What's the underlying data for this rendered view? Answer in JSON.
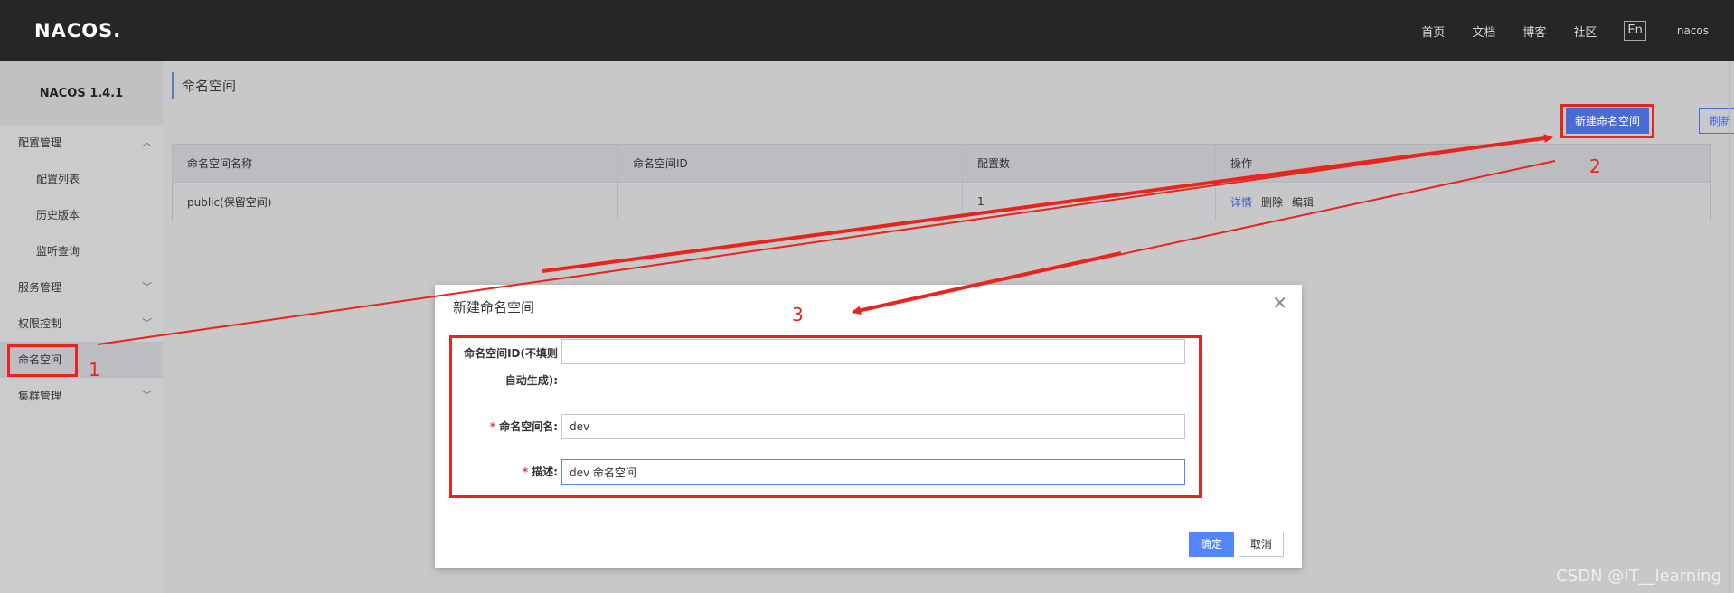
{
  "header": {
    "logo": "NACOS.",
    "nav": [
      "首页",
      "文档",
      "博客",
      "社区"
    ],
    "lang": "En",
    "user": "nacos"
  },
  "sidebar": {
    "version": "NACOS 1.4.1",
    "items": [
      {
        "label": "配置管理",
        "type": "group",
        "chevron": "up"
      },
      {
        "label": "配置列表",
        "type": "sub"
      },
      {
        "label": "历史版本",
        "type": "sub"
      },
      {
        "label": "监听查询",
        "type": "sub"
      },
      {
        "label": "服务管理",
        "type": "group",
        "chevron": "down"
      },
      {
        "label": "权限控制",
        "type": "group",
        "chevron": "down"
      },
      {
        "label": "命名空间",
        "type": "item",
        "active": true
      },
      {
        "label": "集群管理",
        "type": "group",
        "chevron": "down"
      }
    ]
  },
  "main": {
    "title": "命名空间",
    "new_button": "新建命名空间",
    "refresh_button": "刷新",
    "table": {
      "columns": [
        "命名空间名称",
        "命名空间ID",
        "配置数",
        "操作"
      ],
      "rows": [
        {
          "name": "public(保留空间)",
          "id": "",
          "count": "1",
          "actions": [
            "详情",
            "删除",
            "编辑"
          ]
        }
      ]
    }
  },
  "dialog": {
    "title": "新建命名空间",
    "fields": [
      {
        "label_line1": "命名空间ID(不填则",
        "label_line2": "自动生成):",
        "value": "",
        "required": false
      },
      {
        "label": "命名空间名:",
        "value": "dev",
        "required": true
      },
      {
        "label": "描述:",
        "value": "dev 命名空间",
        "required": true
      }
    ],
    "ok": "确定",
    "cancel": "取消"
  },
  "annotations": [
    "1",
    "2",
    "3"
  ],
  "watermark": "CSDN @IT__learning",
  "colors": {
    "accent": "#4a6bd6",
    "annotation": "#e8241c",
    "topbar": "#262626"
  }
}
